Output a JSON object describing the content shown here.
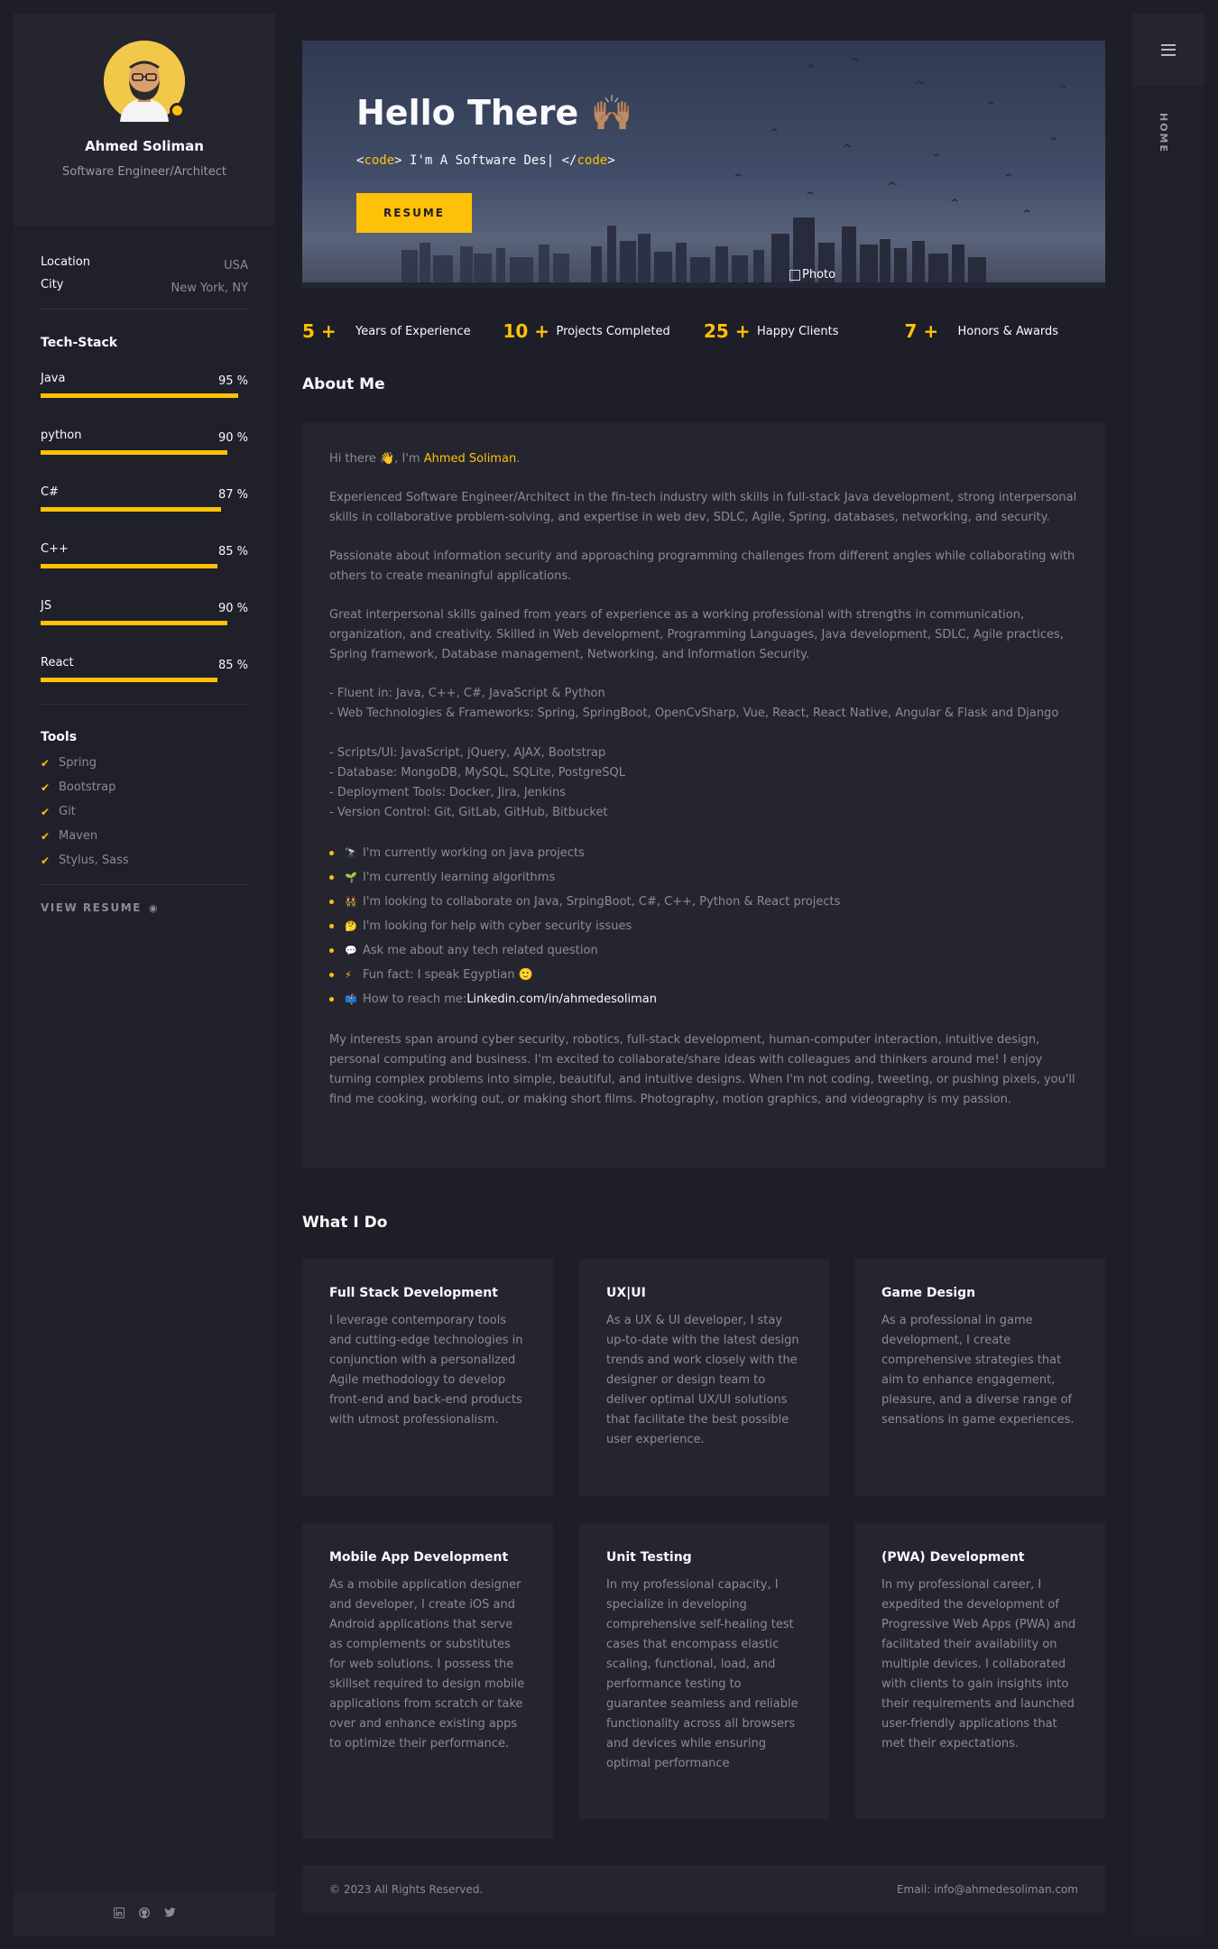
{
  "profile": {
    "name": "Ahmed Soliman",
    "role": "Software Engineer/Architect"
  },
  "info": [
    {
      "label": "Location",
      "value": "USA"
    },
    {
      "label": "City",
      "value": "New York, NY"
    }
  ],
  "tech_stack": {
    "title": "Tech-Stack",
    "skills": [
      {
        "name": "Java",
        "percent_label": "95 %",
        "percent": 95
      },
      {
        "name": "python",
        "percent_label": "90 %",
        "percent": 90
      },
      {
        "name": "C#",
        "percent_label": "87 %",
        "percent": 87
      },
      {
        "name": "C++",
        "percent_label": "85 %",
        "percent": 85
      },
      {
        "name": "JS",
        "percent_label": "90 %",
        "percent": 90
      },
      {
        "name": "React",
        "percent_label": "85 %",
        "percent": 85
      }
    ]
  },
  "tools": {
    "title": "Tools",
    "items": [
      "Spring",
      "Bootstrap",
      "Git",
      "Maven",
      "Stylus, Sass"
    ]
  },
  "view_resume": "VIEW RESUME",
  "rail": {
    "label": "HOME"
  },
  "hero": {
    "title": "Hello There 🙌🏽",
    "code_open_lt": "<",
    "code_tag": "code",
    "code_open_gt": ">",
    "code_text": " I'm A Software Des",
    "code_cursor": "|",
    "code_close_lt": " </",
    "code_close_gt": ">",
    "resume_button": "RESUME",
    "image_alt": "Photo"
  },
  "counters": [
    {
      "num": "5 +",
      "label": "Years of Experience"
    },
    {
      "num": "10 +",
      "label": "Projects Completed"
    },
    {
      "num": "25 +",
      "label": "Happy Clients"
    },
    {
      "num": "7 +",
      "label": "Honors & Awards"
    }
  ],
  "about": {
    "title": "About Me",
    "greeting_pre": "Hi there 👋, I'm ",
    "greeting_name": "Ahmed Soliman",
    "greeting_post": ".",
    "p1": "Experienced Software Engineer/Architect in the fin-tech industry with skills in full-stack Java development, strong interpersonal skills in collaborative problem-solving, and expertise in web dev, SDLC, Agile, Spring, databases, networking, and security.",
    "p2": "Passionate about information security and approaching programming challenges from different angles while collaborating with others to create meaningful applications.",
    "p3": "Great interpersonal skills gained from years of experience as a working professional with strengths in communication, organization, and creativity. Skilled in Web development, Programming Languages, Java development, SDLC, Agile practices, Spring framework, Database management, Networking, and Information Security.",
    "lines": [
      "- Fluent in: Java, C++, C#, JavaScript & Python",
      "- Web Technologies & Frameworks: Spring, SpringBoot, OpenCvSharp, Vue, React, React Native, Angular & Flask and Django",
      "- Scripts/UI: JavaScript, jQuery, AJAX, Bootstrap",
      "- Database: MongoDB, MySQL, SQLite, PostgreSQL",
      "- Deployment Tools: Docker, Jira, Jenkins",
      "- Version Control: Git, GitLab, GitHub, Bitbucket"
    ],
    "bullets": [
      {
        "emoji": "🔭",
        "text": "I'm currently working on java projects"
      },
      {
        "emoji": "🌱",
        "text": "I'm currently learning algorithms"
      },
      {
        "emoji": "👯",
        "text": "I'm looking to collaborate on Java, SrpingBoot, C#, C++, Python & React projects"
      },
      {
        "emoji": "🤔",
        "text": "I'm looking for help with cyber security issues"
      },
      {
        "emoji": "💬",
        "text": "Ask me about any tech related question"
      },
      {
        "emoji": "⚡",
        "text": "Fun fact: I speak Egyptian 🙂"
      }
    ],
    "reach_label": "How to reach me: ",
    "reach_emoji": "📫",
    "reach_link": "Linkedin.com/in/ahmedesoliman",
    "p4": "My interests span around cyber security, robotics, full-stack development, human-computer interaction, intuitive design, personal computing and business. I'm excited to collaborate/share ideas with colleagues and thinkers around me! I enjoy turning complex problems into simple, beautiful, and intuitive designs. When I'm not coding, tweeting, or pushing pixels, you'll find me cooking, working out, or making short films. Photography, motion graphics, and videography is my passion."
  },
  "services": {
    "title": "What I Do",
    "items": [
      {
        "title": "Full Stack Development",
        "text": "I leverage contemporary tools and cutting-edge technologies in conjunction with a personalized Agile methodology to develop front-end and back-end products with utmost professionalism."
      },
      {
        "title": "UX|UI",
        "text": "As a UX & UI developer, I stay up-to-date with the latest design trends and work closely with the designer or design team to deliver optimal UX/UI solutions that facilitate the best possible user experience."
      },
      {
        "title": "Game Design",
        "text": "As a professional in game development, I create comprehensive strategies that aim to enhance engagement, pleasure, and a diverse range of sensations in game experiences."
      },
      {
        "title": "Mobile App Development",
        "text": "As a mobile application designer and developer, I create iOS and Android applications that serve as complements or substitutes for web solutions. I possess the skillset required to design mobile applications from scratch or take over and enhance existing apps to optimize their performance."
      },
      {
        "title": "Unit Testing",
        "text": "In my professional capacity, I specialize in developing comprehensive self-healing test cases that encompass elastic scaling, functional, load, and performance testing to guarantee seamless and reliable functionality across all browsers and devices while ensuring optimal performance"
      },
      {
        "title": "(PWA) Development",
        "text": "In my professional career, I expedited the development of Progressive Web Apps (PWA) and facilitated their availability on multiple devices. I collaborated with clients to gain insights into their requirements and launched user-friendly applications that met their expectations."
      }
    ]
  },
  "footer": {
    "copyright": "© 2023 All Rights Reserved.",
    "email": "Email: info@ahmedesoliman.com"
  },
  "social_icons": [
    "linkedin-icon",
    "github-icon",
    "twitter-icon"
  ],
  "colors": {
    "accent": "#ffc107",
    "background": "#1e1e28",
    "card": "#252530"
  }
}
